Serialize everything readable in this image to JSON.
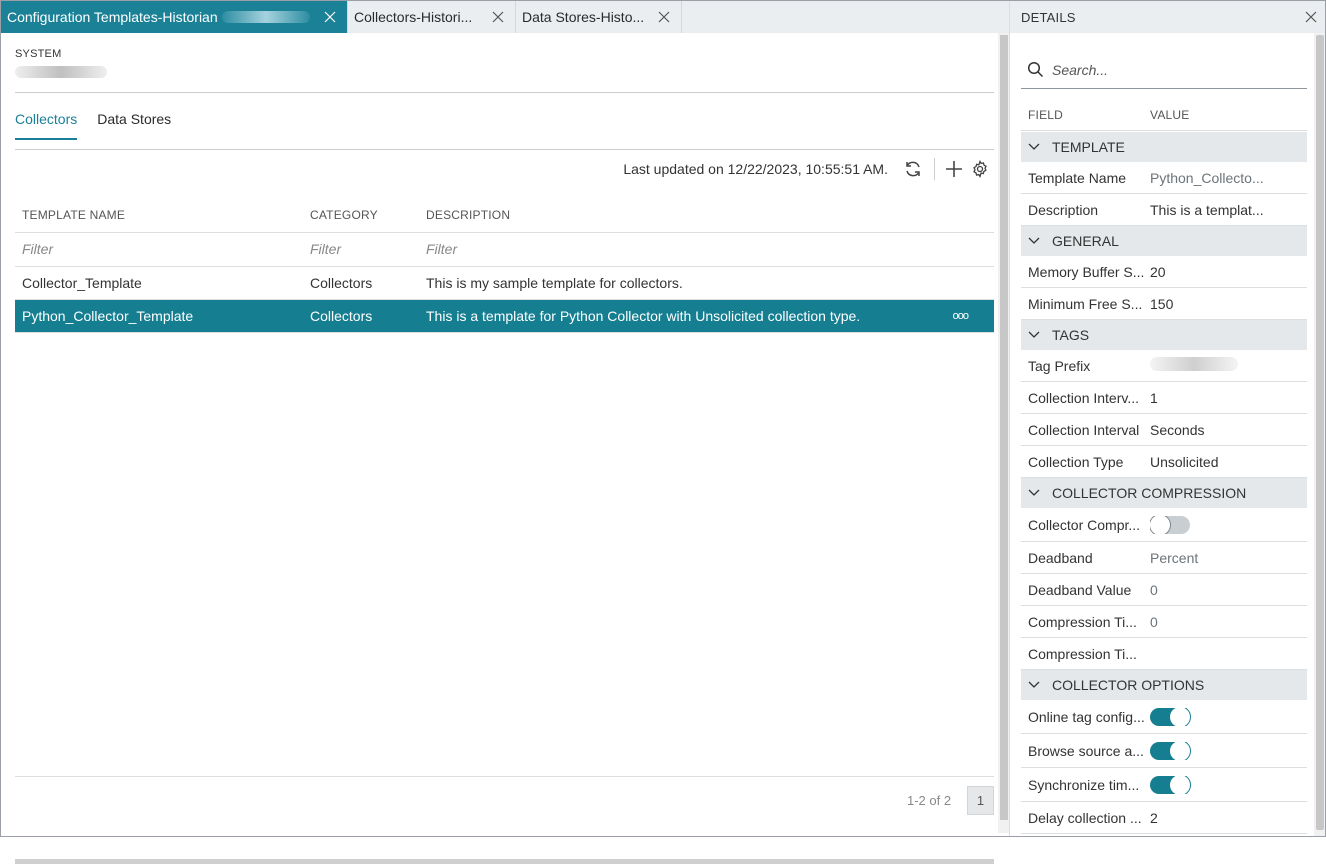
{
  "tabs": [
    {
      "label": "Configuration Templates-Historian",
      "active": true
    },
    {
      "label": "Collectors-Histori...",
      "active": false
    },
    {
      "label": "Data Stores-Histo...",
      "active": false
    }
  ],
  "main": {
    "system_label": "SYSTEM",
    "subtabs": [
      "Collectors",
      "Data Stores"
    ],
    "last_updated": "Last updated on 12/22/2023, 10:55:51 AM.",
    "columns": [
      "TEMPLATE NAME",
      "CATEGORY",
      "DESCRIPTION"
    ],
    "filters": [
      "Filter",
      "Filter",
      "Filter"
    ],
    "rows": [
      {
        "name": "Collector_Template",
        "category": "Collectors",
        "description": "This is my sample template for collectors."
      },
      {
        "name": "Python_Collector_Template",
        "category": "Collectors",
        "description": "This is a template for Python Collector with Unsolicited collection type.",
        "selected": true
      }
    ],
    "row_menu": "ooo",
    "pagination": {
      "info": "1-2 of 2",
      "page": "1"
    }
  },
  "details": {
    "title": "DETAILS",
    "search_placeholder": "Search...",
    "field_header": "FIELD",
    "value_header": "VALUE",
    "sections": {
      "template": {
        "title": "TEMPLATE",
        "rows": [
          {
            "field": "Template Name",
            "value": "Python_Collecto..."
          },
          {
            "field": "Description",
            "value": "This is a templat..."
          }
        ]
      },
      "general": {
        "title": "GENERAL",
        "rows": [
          {
            "field": "Memory Buffer S...",
            "value": "20"
          },
          {
            "field": "Minimum Free S...",
            "value": "150"
          }
        ]
      },
      "tags": {
        "title": "TAGS",
        "rows": [
          {
            "field": "Tag Prefix",
            "value": ""
          },
          {
            "field": "Collection Interv...",
            "value": "1"
          },
          {
            "field": "Collection Interval",
            "value": "Seconds"
          },
          {
            "field": "Collection Type",
            "value": "Unsolicited"
          }
        ]
      },
      "compression": {
        "title": "COLLECTOR COMPRESSION",
        "rows": [
          {
            "field": "Collector Compr...",
            "value": "off"
          },
          {
            "field": "Deadband",
            "value": "Percent"
          },
          {
            "field": "Deadband Value",
            "value": "0"
          },
          {
            "field": "Compression Ti...",
            "value": "0"
          },
          {
            "field": "Compression Ti...",
            "value": ""
          }
        ]
      },
      "options": {
        "title": "COLLECTOR OPTIONS",
        "rows": [
          {
            "field": "Online tag config...",
            "value": "on"
          },
          {
            "field": "Browse source a...",
            "value": "on"
          },
          {
            "field": "Synchronize tim...",
            "value": "on"
          },
          {
            "field": "Delay collection ...",
            "value": "2"
          }
        ]
      }
    }
  },
  "colors": {
    "accent": "#157e91",
    "tabbar": "#eaeef1",
    "section_bg": "#e4e8eb"
  }
}
